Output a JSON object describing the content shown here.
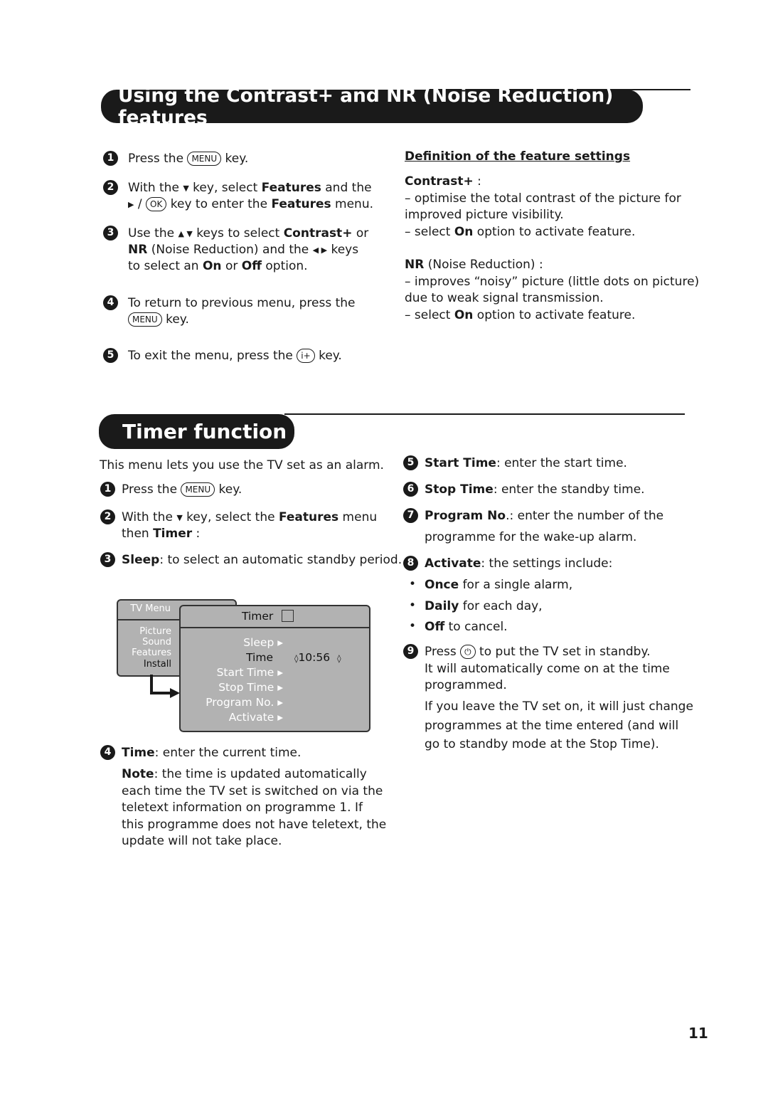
{
  "section1": {
    "title": "Using the Contrast+ and NR (Noise Reduction) features",
    "steps": [
      {
        "n": "1",
        "lines": [
          [
            {
              "t": "Press the "
            },
            {
              "k": "MENU"
            },
            {
              "t": " key."
            }
          ]
        ]
      },
      {
        "n": "2",
        "lines": [
          [
            {
              "t": "With the "
            },
            {
              "tri": "▼"
            },
            {
              "t": " key, select "
            },
            {
              "b": "Features"
            },
            {
              "t": " and the"
            }
          ],
          [
            {
              "tri": "▶"
            },
            {
              "t": " / "
            },
            {
              "k": "OK"
            },
            {
              "t": " key to enter the "
            },
            {
              "b": "Features"
            },
            {
              "t": " menu."
            }
          ]
        ]
      },
      {
        "n": "3",
        "lines": [
          [
            {
              "t": "Use the "
            },
            {
              "tri": "▲ ▼"
            },
            {
              "t": " keys to select "
            },
            {
              "b": "Contrast+"
            },
            {
              "t": " or"
            }
          ],
          [
            {
              "b": "NR"
            },
            {
              "t": " (Noise Reduction) and the "
            },
            {
              "tri": "◀  ▶"
            },
            {
              "t": " keys"
            }
          ],
          [
            {
              "t": "to select an "
            },
            {
              "b": "On"
            },
            {
              "t": " or "
            },
            {
              "b": "Off"
            },
            {
              "t": " option."
            }
          ]
        ]
      },
      {
        "n": "4",
        "lines": [
          [
            {
              "t": "To return to previous menu, press the"
            }
          ],
          [
            {
              "k": "MENU"
            },
            {
              "t": " key."
            }
          ]
        ]
      },
      {
        "n": "5",
        "lines": [
          [
            {
              "t": "To exit the menu, press the "
            },
            {
              "k": "  i+  "
            },
            {
              "t": " key."
            }
          ]
        ]
      }
    ],
    "definitions": {
      "heading": "Definition of the feature settings",
      "blocks": [
        {
          "lines": [
            [
              {
                "b": "Contrast+"
              },
              {
                "t": " :"
              }
            ],
            [
              {
                "t": "– optimise the total contrast of the picture for"
              }
            ],
            [
              {
                "t": "   improved picture visibility."
              }
            ],
            [
              {
                "t": "– select "
              },
              {
                "b": "On"
              },
              {
                "t": " option to activate feature."
              }
            ]
          ]
        },
        {
          "lines": [
            [
              {
                "b": "NR"
              },
              {
                "t": " (Noise Reduction) :"
              }
            ],
            [
              {
                "t": "– improves “noisy” picture (little dots on picture)"
              }
            ],
            [
              {
                "t": "   due to weak signal transmission."
              }
            ],
            [
              {
                "t": "– select "
              },
              {
                "b": "On"
              },
              {
                "t": " option to activate feature."
              }
            ]
          ]
        }
      ]
    }
  },
  "section2": {
    "title": "Timer function",
    "intro": [
      [
        {
          "t": "This menu lets you use the TV set as an alarm."
        }
      ]
    ],
    "left": [
      {
        "n": "1",
        "lines": [
          [
            {
              "t": "Press the "
            },
            {
              "k": "MENU"
            },
            {
              "t": " key."
            }
          ]
        ]
      },
      {
        "n": "2",
        "lines": [
          [
            {
              "t": "With the "
            },
            {
              "tri": "▼"
            },
            {
              "t": " key, select the "
            },
            {
              "b": "Features"
            },
            {
              "t": " menu"
            }
          ],
          [
            {
              "t": "then "
            },
            {
              "b": "Timer"
            },
            {
              "t": " :"
            }
          ]
        ]
      },
      {
        "n": "3",
        "lines": [
          [
            {
              "b": "Sleep"
            },
            {
              "t": ": to select an automatic standby period."
            }
          ]
        ]
      },
      {
        "n": "4",
        "lines": [
          [
            {
              "b": "Time"
            },
            {
              "t": ": enter the current time."
            }
          ]
        ]
      }
    ],
    "note": [
      [
        {
          "b": "Note"
        },
        {
          "t": ": the time is updated automatically"
        }
      ],
      [
        {
          "t": "each time the TV set is switched on via the"
        }
      ],
      [
        {
          "t": "teletext information on programme 1. If"
        }
      ],
      [
        {
          "t": "this programme does not have teletext, the"
        }
      ],
      [
        {
          "t": "update will not take place."
        }
      ]
    ],
    "right": [
      {
        "n": "5",
        "lines": [
          [
            {
              "b": "Start Time"
            },
            {
              "t": ": enter the start time."
            }
          ]
        ]
      },
      {
        "n": "6",
        "lines": [
          [
            {
              "b": "Stop Time"
            },
            {
              "t": ": enter the standby time."
            }
          ]
        ]
      },
      {
        "n": "7",
        "lines": [
          [
            {
              "b": "Program No"
            },
            {
              "t": ".: enter the number of the"
            }
          ],
          [
            {
              "t": "programme for the wake-up alarm."
            }
          ]
        ]
      },
      {
        "n": "8",
        "lines": [
          [
            {
              "b": "Activate"
            },
            {
              "t": ": the settings include:"
            }
          ]
        ]
      },
      {
        "n": "9",
        "lines": [
          [
            {
              "t": "Press "
            },
            {
              "k": "  ⏻  "
            },
            {
              "t": " to put the TV set in standby."
            }
          ],
          [
            {
              "t": "It will automatically come on at the time"
            }
          ],
          [
            {
              "t": "programmed."
            }
          ]
        ]
      }
    ],
    "bullets": [
      [
        {
          "b": "Once"
        },
        {
          "t": " for a single alarm,"
        }
      ],
      [
        {
          "b": "Daily"
        },
        {
          "t": " for each day,"
        }
      ],
      [
        {
          "b": "Off"
        },
        {
          "t": " to cancel."
        }
      ]
    ],
    "tail": [
      [
        {
          "t": "If you leave the TV set on, it will just change"
        }
      ],
      [
        {
          "t": "programmes at the time entered (and will"
        }
      ],
      [
        {
          "t": "go to standby mode at the Stop Time)."
        }
      ]
    ],
    "menu": {
      "tv_menu_title": "TV Menu",
      "tv_menu_items": [
        "Picture",
        "Sound",
        "Features",
        "Install"
      ],
      "timer_title": "Timer",
      "timer_items": [
        "Sleep ▸",
        "Time",
        "Start Time ▸",
        "Stop Time ▸",
        "Program No. ▸",
        "Activate ▸"
      ],
      "time_value": "10:56"
    }
  },
  "page_number": "11"
}
